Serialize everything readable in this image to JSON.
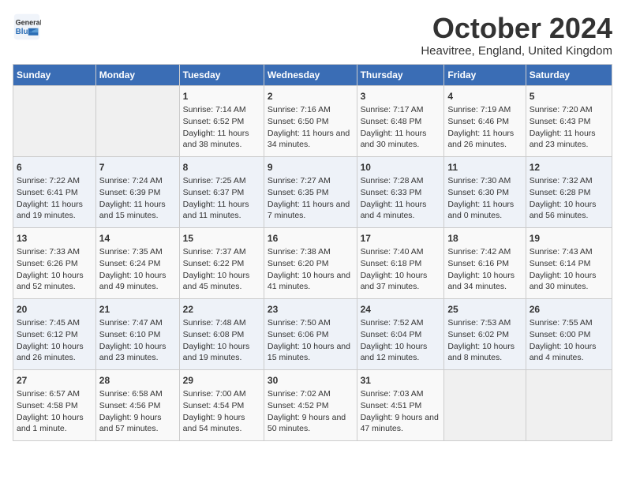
{
  "header": {
    "logo_general": "General",
    "logo_blue": "Blue",
    "month_title": "October 2024",
    "location": "Heavitree, England, United Kingdom"
  },
  "weekdays": [
    "Sunday",
    "Monday",
    "Tuesday",
    "Wednesday",
    "Thursday",
    "Friday",
    "Saturday"
  ],
  "weeks": [
    [
      {
        "day": "",
        "empty": true
      },
      {
        "day": "",
        "empty": true
      },
      {
        "day": "1",
        "sunrise": "Sunrise: 7:14 AM",
        "sunset": "Sunset: 6:52 PM",
        "daylight": "Daylight: 11 hours and 38 minutes."
      },
      {
        "day": "2",
        "sunrise": "Sunrise: 7:16 AM",
        "sunset": "Sunset: 6:50 PM",
        "daylight": "Daylight: 11 hours and 34 minutes."
      },
      {
        "day": "3",
        "sunrise": "Sunrise: 7:17 AM",
        "sunset": "Sunset: 6:48 PM",
        "daylight": "Daylight: 11 hours and 30 minutes."
      },
      {
        "day": "4",
        "sunrise": "Sunrise: 7:19 AM",
        "sunset": "Sunset: 6:46 PM",
        "daylight": "Daylight: 11 hours and 26 minutes."
      },
      {
        "day": "5",
        "sunrise": "Sunrise: 7:20 AM",
        "sunset": "Sunset: 6:43 PM",
        "daylight": "Daylight: 11 hours and 23 minutes."
      }
    ],
    [
      {
        "day": "6",
        "sunrise": "Sunrise: 7:22 AM",
        "sunset": "Sunset: 6:41 PM",
        "daylight": "Daylight: 11 hours and 19 minutes."
      },
      {
        "day": "7",
        "sunrise": "Sunrise: 7:24 AM",
        "sunset": "Sunset: 6:39 PM",
        "daylight": "Daylight: 11 hours and 15 minutes."
      },
      {
        "day": "8",
        "sunrise": "Sunrise: 7:25 AM",
        "sunset": "Sunset: 6:37 PM",
        "daylight": "Daylight: 11 hours and 11 minutes."
      },
      {
        "day": "9",
        "sunrise": "Sunrise: 7:27 AM",
        "sunset": "Sunset: 6:35 PM",
        "daylight": "Daylight: 11 hours and 7 minutes."
      },
      {
        "day": "10",
        "sunrise": "Sunrise: 7:28 AM",
        "sunset": "Sunset: 6:33 PM",
        "daylight": "Daylight: 11 hours and 4 minutes."
      },
      {
        "day": "11",
        "sunrise": "Sunrise: 7:30 AM",
        "sunset": "Sunset: 6:30 PM",
        "daylight": "Daylight: 11 hours and 0 minutes."
      },
      {
        "day": "12",
        "sunrise": "Sunrise: 7:32 AM",
        "sunset": "Sunset: 6:28 PM",
        "daylight": "Daylight: 10 hours and 56 minutes."
      }
    ],
    [
      {
        "day": "13",
        "sunrise": "Sunrise: 7:33 AM",
        "sunset": "Sunset: 6:26 PM",
        "daylight": "Daylight: 10 hours and 52 minutes."
      },
      {
        "day": "14",
        "sunrise": "Sunrise: 7:35 AM",
        "sunset": "Sunset: 6:24 PM",
        "daylight": "Daylight: 10 hours and 49 minutes."
      },
      {
        "day": "15",
        "sunrise": "Sunrise: 7:37 AM",
        "sunset": "Sunset: 6:22 PM",
        "daylight": "Daylight: 10 hours and 45 minutes."
      },
      {
        "day": "16",
        "sunrise": "Sunrise: 7:38 AM",
        "sunset": "Sunset: 6:20 PM",
        "daylight": "Daylight: 10 hours and 41 minutes."
      },
      {
        "day": "17",
        "sunrise": "Sunrise: 7:40 AM",
        "sunset": "Sunset: 6:18 PM",
        "daylight": "Daylight: 10 hours and 37 minutes."
      },
      {
        "day": "18",
        "sunrise": "Sunrise: 7:42 AM",
        "sunset": "Sunset: 6:16 PM",
        "daylight": "Daylight: 10 hours and 34 minutes."
      },
      {
        "day": "19",
        "sunrise": "Sunrise: 7:43 AM",
        "sunset": "Sunset: 6:14 PM",
        "daylight": "Daylight: 10 hours and 30 minutes."
      }
    ],
    [
      {
        "day": "20",
        "sunrise": "Sunrise: 7:45 AM",
        "sunset": "Sunset: 6:12 PM",
        "daylight": "Daylight: 10 hours and 26 minutes."
      },
      {
        "day": "21",
        "sunrise": "Sunrise: 7:47 AM",
        "sunset": "Sunset: 6:10 PM",
        "daylight": "Daylight: 10 hours and 23 minutes."
      },
      {
        "day": "22",
        "sunrise": "Sunrise: 7:48 AM",
        "sunset": "Sunset: 6:08 PM",
        "daylight": "Daylight: 10 hours and 19 minutes."
      },
      {
        "day": "23",
        "sunrise": "Sunrise: 7:50 AM",
        "sunset": "Sunset: 6:06 PM",
        "daylight": "Daylight: 10 hours and 15 minutes."
      },
      {
        "day": "24",
        "sunrise": "Sunrise: 7:52 AM",
        "sunset": "Sunset: 6:04 PM",
        "daylight": "Daylight: 10 hours and 12 minutes."
      },
      {
        "day": "25",
        "sunrise": "Sunrise: 7:53 AM",
        "sunset": "Sunset: 6:02 PM",
        "daylight": "Daylight: 10 hours and 8 minutes."
      },
      {
        "day": "26",
        "sunrise": "Sunrise: 7:55 AM",
        "sunset": "Sunset: 6:00 PM",
        "daylight": "Daylight: 10 hours and 4 minutes."
      }
    ],
    [
      {
        "day": "27",
        "sunrise": "Sunrise: 6:57 AM",
        "sunset": "Sunset: 4:58 PM",
        "daylight": "Daylight: 10 hours and 1 minute."
      },
      {
        "day": "28",
        "sunrise": "Sunrise: 6:58 AM",
        "sunset": "Sunset: 4:56 PM",
        "daylight": "Daylight: 9 hours and 57 minutes."
      },
      {
        "day": "29",
        "sunrise": "Sunrise: 7:00 AM",
        "sunset": "Sunset: 4:54 PM",
        "daylight": "Daylight: 9 hours and 54 minutes."
      },
      {
        "day": "30",
        "sunrise": "Sunrise: 7:02 AM",
        "sunset": "Sunset: 4:52 PM",
        "daylight": "Daylight: 9 hours and 50 minutes."
      },
      {
        "day": "31",
        "sunrise": "Sunrise: 7:03 AM",
        "sunset": "Sunset: 4:51 PM",
        "daylight": "Daylight: 9 hours and 47 minutes."
      },
      {
        "day": "",
        "empty": true
      },
      {
        "day": "",
        "empty": true
      }
    ]
  ]
}
